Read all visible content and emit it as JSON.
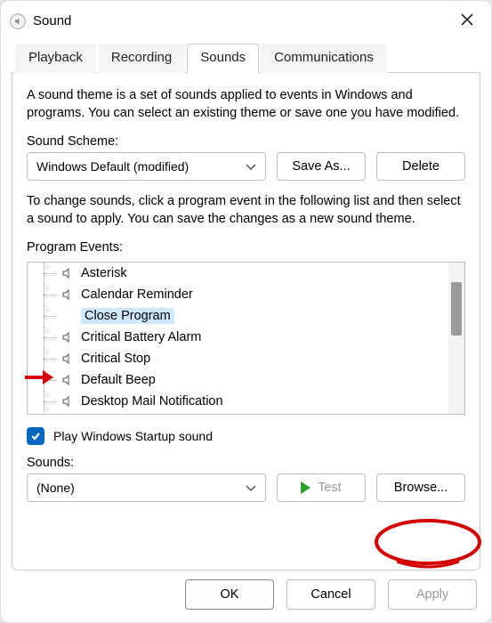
{
  "titlebar": {
    "title": "Sound"
  },
  "tabs": {
    "playback": "Playback",
    "recording": "Recording",
    "sounds": "Sounds",
    "communications": "Communications"
  },
  "pane": {
    "description": "A sound theme is a set of sounds applied to events in Windows and programs. You can select an existing theme or save one you have modified.",
    "scheme_label": "Sound Scheme:",
    "scheme_value": "Windows Default (modified)",
    "save_as": "Save As...",
    "delete": "Delete",
    "change_desc": "To change sounds, click a program event in the following list and then select a sound to apply. You can save the changes as a new sound theme.",
    "events_label": "Program Events:",
    "events": {
      "asterisk": "Asterisk",
      "calendar_reminder": "Calendar Reminder",
      "close_program": "Close Program",
      "critical_battery_alarm": "Critical Battery Alarm",
      "critical_stop": "Critical Stop",
      "default_beep": "Default Beep",
      "desktop_mail_notification": "Desktop Mail Notification"
    },
    "startup_label": "Play Windows Startup sound",
    "sounds_label": "Sounds:",
    "sounds_value": "(None)",
    "test": "Test",
    "browse": "Browse..."
  },
  "buttons": {
    "ok": "OK",
    "cancel": "Cancel",
    "apply": "Apply"
  }
}
